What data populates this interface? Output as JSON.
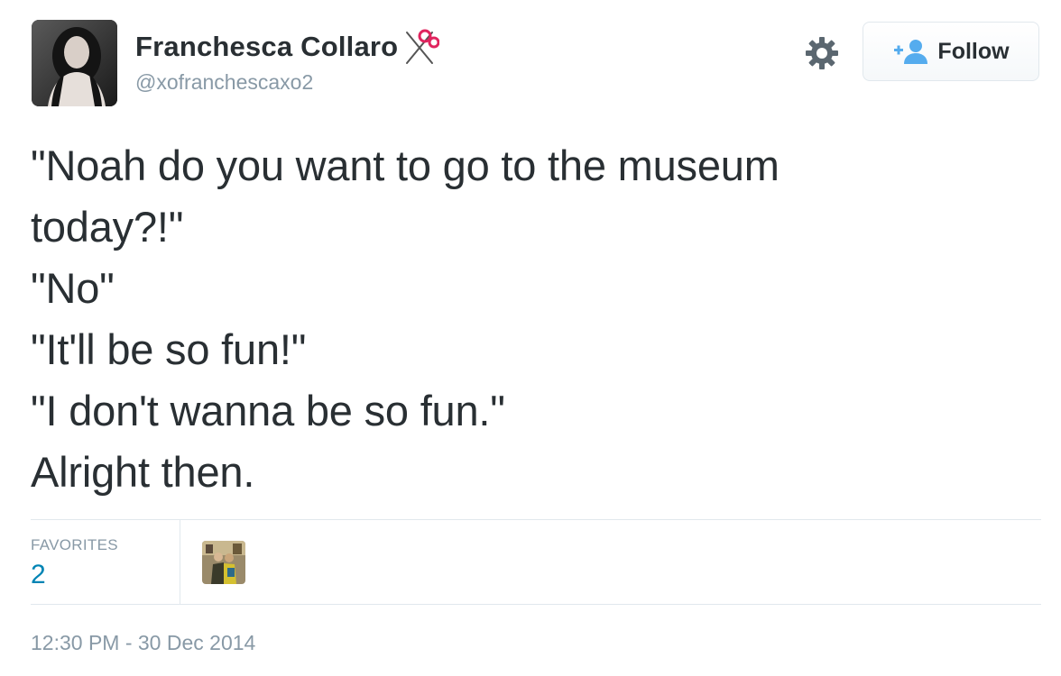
{
  "user": {
    "display_name": "Franchesca Collaro",
    "screen_name": "@xofranchescaxo2",
    "name_emoji": "scissors-icon"
  },
  "actions": {
    "settings_icon": "gear-icon",
    "follow_label": "Follow",
    "follow_icon": "add-user-icon"
  },
  "tweet": {
    "lines": [
      "\"Noah do you want to go to the museum",
      "today?!\"",
      "\"No\"",
      "\"It'll be so fun!\"",
      "\"I don't wanna be so fun.\"",
      "Alright then."
    ]
  },
  "stats": {
    "favorites_label": "FAVORITES",
    "favorites_count": "2"
  },
  "timestamp": "12:30 PM - 30 Dec 2014",
  "colors": {
    "text": "#292f33",
    "muted": "#8899a6",
    "link": "#0084b4",
    "divider": "#e1e8ed",
    "follow_icon": "#55acee"
  }
}
